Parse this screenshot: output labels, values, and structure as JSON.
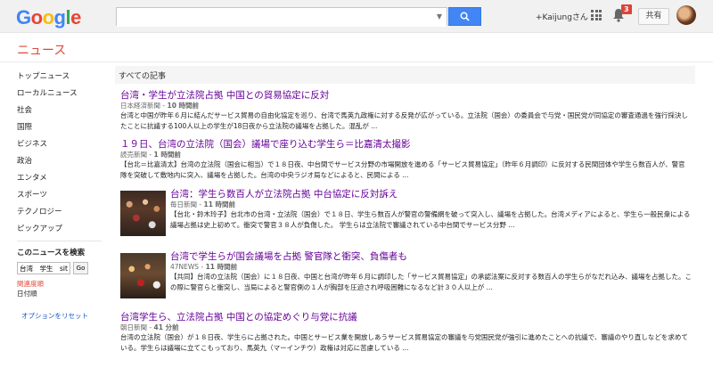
{
  "logo": "Google",
  "search": {
    "value": "",
    "placeholder": ""
  },
  "user": {
    "name": "+Kaijungさん",
    "notification_count": "3",
    "share_label": "共有"
  },
  "section_title": "ニュース",
  "nav": {
    "items": [
      "トップニュース",
      "ローカルニュース",
      "社会",
      "国際",
      "ビジネス",
      "政治",
      "エンタメ",
      "スポーツ",
      "テクノロジー",
      "ピックアップ"
    ],
    "search_title": "このニュースを検索",
    "search_value": "台湾　学生　sit",
    "go_label": "Go",
    "sort_relevance": "関連度順",
    "sort_date": "日付順",
    "reset_options": "オプションをリセット"
  },
  "main": {
    "header": "すべての記事",
    "articles": [
      {
        "title": "台湾・学生が立法院占拠 中国との貿易協定に反対",
        "source": "日本経済新聞",
        "time": "10 時間前",
        "snippet": "台湾と中国が昨年６月に結んだサービス貿易の自由化協定を巡り、台湾で馬英九政権に対する反発が広がっている。立法院（国会）の委員会で与党・国民党が同協定の審査通過を強行採決したことに抗議する100人以上の学生が18日夜から立法院の議場を占拠した。混乱が ..."
      },
      {
        "title": "１９日、台湾の立法院（国会）議場で座り込む学生ら＝比嘉清太撮影",
        "source": "読売新聞",
        "time": "1 時間前",
        "snippet": "【台北＝比嘉清太】台湾の立法院（国会に相当）で１８日夜、中台間でサービス分野の市場開放を進める「サービス貿易協定」（昨年６月調印）に反対する民間団体や学生ら数百人が、警官隊を突破して敷地内に突入、議場を占拠した。台湾の中央ラジオ局などによると、民間による ..."
      },
      {
        "title": "台湾：学生ら数百人が立法院占拠 中台協定に反対訴え",
        "source": "毎日新聞",
        "time": "11 時間前",
        "snippet": "【台北・鈴木玲子】台北市の台湾・立法院（国会）で１８日、学生ら数百人が警官の警備網を破って突入し、議場を占拠した。台湾メディアによると、学生ら一般民衆による議場占拠は史上初めて。衝突で警官３８人が負傷した。 学生らは立法院で審議されている中台間でサービス分野 ..."
      },
      {
        "title": "台湾で学生らが国会議場を占拠 警官隊と衝突、負傷者も",
        "source": "47NEWS",
        "time": "11 時間前",
        "snippet": "【共同】台湾の立法院（国会）に１８日夜、中国と台湾が昨年６月に調印した「サービス貿易協定」の承認法案に反対する数百人の学生らがなだれ込み、議場を占拠した。この際に警官らと衝突し、当局によると警官側の１人が胸部を圧迫され呼吸困難になるなど計３０人以上が ..."
      },
      {
        "title": "台湾学生ら、立法院占拠 中国との協定めぐり与党に抗議",
        "source": "朝日新聞",
        "time": "41 分前",
        "snippet": "台湾の立法院（国会）が１８日夜、学生らに占拠された。中国とサービス業を開放しあうサービス貿易協定の審議を与党国民党が強引に進めたことへの抗議で、審議のやり直しなどを求めている。学生らは議場に立てこもっており、馬英九（マーインチウ）政権は対応に苦慮している ..."
      }
    ]
  },
  "colors": {
    "accent": "#dd4b39",
    "visited_link": "#660099",
    "blue": "#4285f4"
  },
  "icons": [
    "search-icon",
    "apps-icon",
    "bell-icon",
    "caret-down-icon"
  ]
}
